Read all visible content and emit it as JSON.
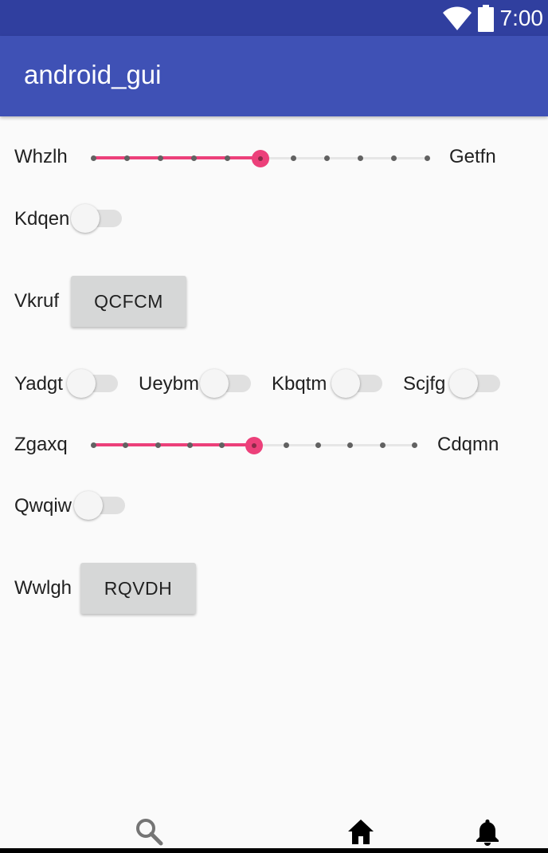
{
  "status_bar": {
    "time": "7:00",
    "icons": [
      "wifi-icon",
      "battery-icon"
    ]
  },
  "app_bar": {
    "title": "android_gui"
  },
  "rows": {
    "seek1": {
      "left_label": "Whzlh",
      "right_label": "Getfn",
      "value": 5,
      "max": 10
    },
    "switch1": {
      "label": "Kdqen",
      "checked": false
    },
    "button1": {
      "label": "Vkruf",
      "button_text": "QCFCM"
    },
    "switches": [
      {
        "label": "Yadgt",
        "checked": false
      },
      {
        "label": "Ueybm",
        "checked": false
      },
      {
        "label": "Kbqtm",
        "checked": false
      },
      {
        "label": "Scjfg",
        "checked": false
      }
    ],
    "seek2": {
      "left_label": "Zgaxq",
      "right_label": "Cdqmn",
      "value": 5,
      "max": 10
    },
    "switch2": {
      "label": "Qwqiw",
      "checked": false
    },
    "button2": {
      "label": "Wwlgh",
      "button_text": "RQVDH"
    }
  },
  "bottom_nav": {
    "icons": [
      "search-icon",
      "home-icon",
      "bell-icon"
    ]
  },
  "colors": {
    "status_bar": "#303f9f",
    "app_bar": "#3f51b5",
    "accent": "#ec407a",
    "background": "#fafafa"
  }
}
